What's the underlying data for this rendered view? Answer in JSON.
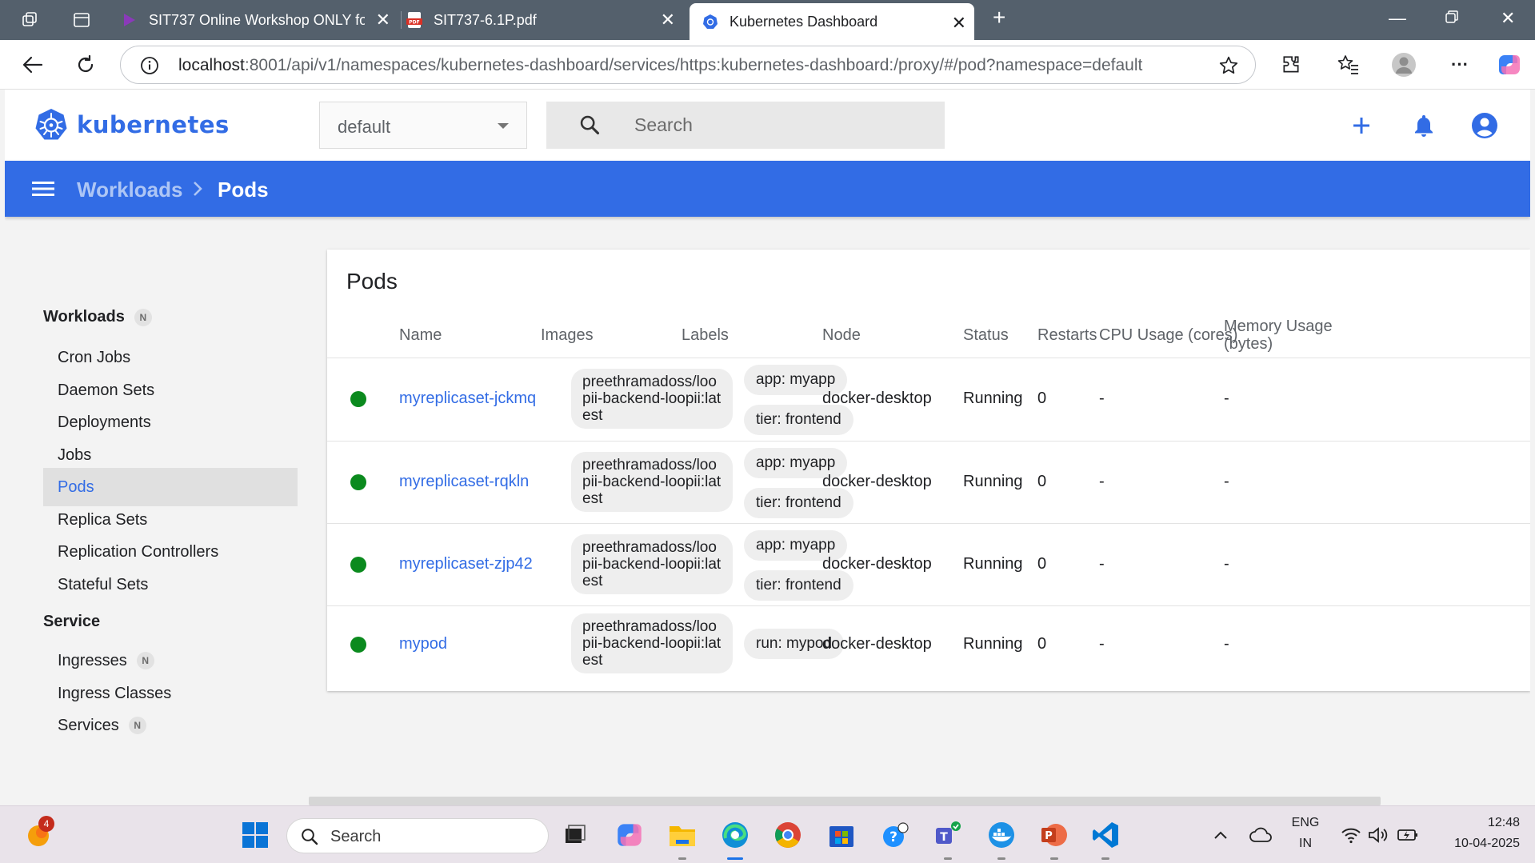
{
  "browser": {
    "tabs": [
      {
        "title": "SIT737 Online Workshop ONLY fo",
        "icon": "streams-icon",
        "active": false
      },
      {
        "title": "SIT737-6.1P.pdf",
        "icon": "pdf-icon",
        "active": false
      },
      {
        "title": "Kubernetes Dashboard",
        "icon": "kubernetes-icon",
        "active": true
      }
    ],
    "address": {
      "host": "localhost",
      "path": ":8001/api/v1/namespaces/kubernetes-dashboard/services/https:kubernetes-dashboard:/proxy/#/pod?namespace=default"
    }
  },
  "header": {
    "logo_text": "kubernetes",
    "namespace": "default",
    "search_placeholder": "Search"
  },
  "toolbar": {
    "breadcrumb_parent": "Workloads",
    "breadcrumb_current": "Pods"
  },
  "sidebar": {
    "workloads_title": "Workloads",
    "workloads_badge": "N",
    "workload_items": [
      "Cron Jobs",
      "Daemon Sets",
      "Deployments",
      "Jobs",
      "Pods",
      "Replica Sets",
      "Replication Controllers",
      "Stateful Sets"
    ],
    "service_title": "Service",
    "service_items": [
      {
        "label": "Ingresses",
        "badge": "N"
      },
      {
        "label": "Ingress Classes",
        "badge": ""
      },
      {
        "label": "Services",
        "badge": "N"
      }
    ]
  },
  "pods": {
    "title": "Pods",
    "columns": {
      "name": "Name",
      "images": "Images",
      "labels": "Labels",
      "node": "Node",
      "status": "Status",
      "restarts": "Restarts",
      "cpu": "CPU Usage (cores)",
      "memory_1": "Memory Usage",
      "memory_2": "(bytes)"
    },
    "rows": [
      {
        "name": "myreplicaset-jckmq",
        "image": "preethramadoss/loopii-backend-loopii:latest",
        "labels": [
          "app: myapp",
          "tier: frontend"
        ],
        "node": "docker-desktop",
        "status": "Running",
        "restarts": "0",
        "cpu": "-",
        "memory": "-"
      },
      {
        "name": "myreplicaset-rqkln",
        "image": "preethramadoss/loopii-backend-loopii:latest",
        "labels": [
          "app: myapp",
          "tier: frontend"
        ],
        "node": "docker-desktop",
        "status": "Running",
        "restarts": "0",
        "cpu": "-",
        "memory": "-"
      },
      {
        "name": "myreplicaset-zjp42",
        "image": "preethramadoss/loopii-backend-loopii:latest",
        "labels": [
          "app: myapp",
          "tier: frontend"
        ],
        "node": "docker-desktop",
        "status": "Running",
        "restarts": "0",
        "cpu": "-",
        "memory": "-"
      },
      {
        "name": "mypod",
        "image": "preethramadoss/loopii-backend-loopii:latest",
        "labels": [
          "run: mypod"
        ],
        "node": "docker-desktop",
        "status": "Running",
        "restarts": "0",
        "cpu": "-",
        "memory": "-"
      }
    ]
  },
  "taskbar": {
    "search_label": "Search",
    "notification_count": "4",
    "language_1": "ENG",
    "language_2": "IN",
    "time": "12:48",
    "date": "10-04-2025"
  },
  "colors": {
    "k8s_blue": "#326ce5",
    "running_green": "#0b8a1e",
    "tab_strip": "#54606c"
  }
}
